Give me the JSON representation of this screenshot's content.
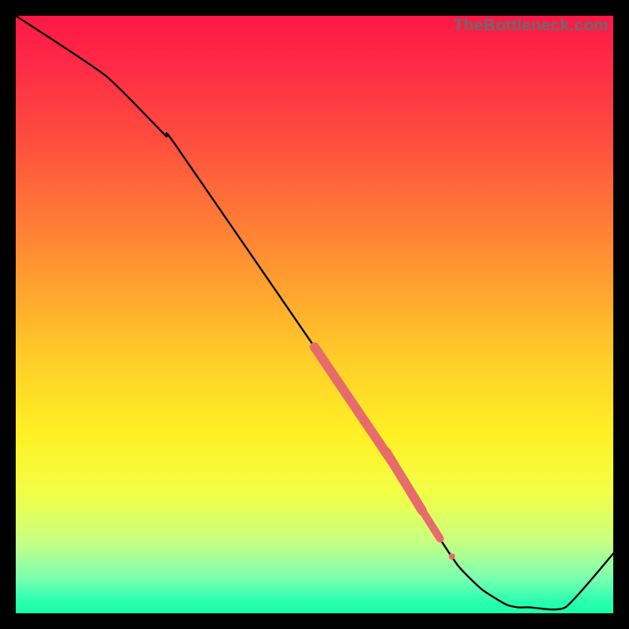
{
  "watermark": "TheBottleneck.com",
  "colors": {
    "background_frame": "#000000",
    "line_stroke": "#000000",
    "marker_fill": "#e86b6b",
    "marker_fill_alt": "#e86b6b",
    "gradient_top": "#ff1846",
    "gradient_bottom": "#17ffa6"
  },
  "chart_data": {
    "type": "line",
    "title": "",
    "xlabel": "",
    "ylabel": "",
    "xlim": [
      0,
      100
    ],
    "ylim": [
      0,
      100
    ],
    "grid": false,
    "legend_position": "none",
    "annotations": [
      "TheBottleneck.com"
    ],
    "series": [
      {
        "name": "curve",
        "x": [
          0,
          15,
          25,
          27,
          60,
          62,
          65,
          70,
          74,
          78,
          82,
          84,
          86,
          92,
          100
        ],
        "y": [
          100,
          90,
          80,
          78,
          30,
          27,
          22,
          14,
          8,
          4,
          1.5,
          1,
          1,
          1,
          10
        ]
      }
    ],
    "markers": [
      {
        "shape": "pill",
        "x_center": 56.5,
        "y_center": 36.0,
        "length_pct": 13.0,
        "radius_px": 6
      },
      {
        "shape": "pill",
        "x_center": 65.0,
        "y_center": 22.5,
        "length_pct": 6.0,
        "radius_px": 6
      },
      {
        "shape": "dot",
        "x": 64.0,
        "y": 24.0,
        "radius_px": 5
      },
      {
        "shape": "pill",
        "x_center": 68.5,
        "y_center": 16.5,
        "length_pct": 5.0,
        "radius_px": 5
      },
      {
        "shape": "dot",
        "x": 73.0,
        "y": 10.0,
        "radius_px": 4
      }
    ]
  }
}
